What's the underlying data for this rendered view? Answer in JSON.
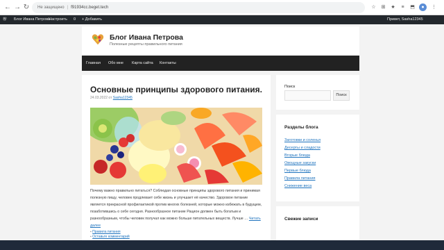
{
  "browser": {
    "back_icon": "←",
    "forward_icon": "→",
    "reload_icon": "↻",
    "security_text": "Не защищено",
    "separator": "|",
    "url": "f91934cc.beget.tech",
    "extensions": [
      "☆",
      "⊞",
      "★",
      "≡",
      "⬒",
      "●",
      "⋮"
    ]
  },
  "adminbar": {
    "wp_icon": "Ⓦ",
    "site_name": "Блог Ивана Петрова",
    "customize": "Настроить",
    "comments": "0",
    "add_new": "+ Добавить",
    "greeting": "Привет, Sasha12345"
  },
  "header": {
    "site_title": "Блог Ивана Петрова",
    "tagline": "Полезные рецепты правильного питания"
  },
  "nav": {
    "items": [
      "Главная",
      "Обо мне",
      "Карта сайта",
      "Контакты"
    ]
  },
  "post": {
    "title": "Основные принципы здорового питания.",
    "date": "24.03.2022",
    "by": "от",
    "author": "Sasha12345",
    "excerpt": "Почему важно правильно питаться? Соблюдая основные принципы здорового питания и принимая полезную пищу, человек продлевает себе жизнь и улучшает её качество. Здоровое питание является прекрасной профилактикой против многих болезней, которые можно избежать в будущем, позаботившись о себе сегодня. Разнообразное питание Рацион должен быть богатым и разнообразным, чтобы человек получал как можно больше питательных веществ. Лучше …",
    "read_more": "Читать далее",
    "category": "Правила питания",
    "comment_link": "Оставьте комментарий"
  },
  "sidebar": {
    "search_label": "Поиск",
    "search_placeholder": "",
    "search_button": "Поиск",
    "categories_title": "Разделы блога",
    "categories": [
      "Заготовки и соленья",
      "Десерты и сладости",
      "Вторые блюда",
      "Овощные закуски",
      "Первые блюда",
      "Правила питания",
      "Снижение веса"
    ],
    "recent_title": "Свежие записи"
  },
  "colors": {
    "link": "#1e73be",
    "nav_bg": "#222222",
    "adminbar_bg": "#23282d",
    "page_bg": "#f3f3f3"
  }
}
